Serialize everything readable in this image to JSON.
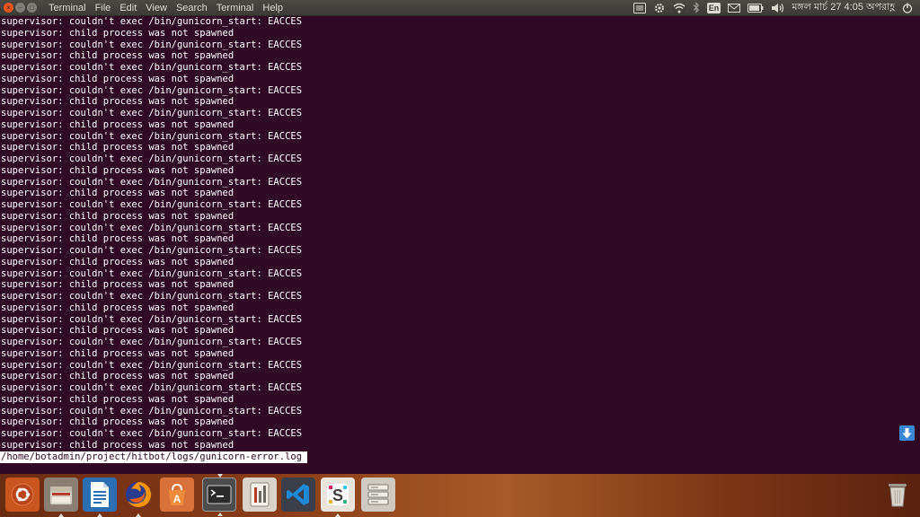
{
  "top_panel": {
    "app_name": "Terminal",
    "menus": [
      "File",
      "Edit",
      "View",
      "Search",
      "Terminal",
      "Help"
    ],
    "keyboard_layout": "En",
    "clock": "মঙ্গল মার্চ 27  4:05 অপরাহ্ণ",
    "icons": [
      "keyboard-icon",
      "settings-gear-icon",
      "wifi-icon",
      "bluetooth-icon",
      "keyboard-language-icon",
      "mail-icon",
      "battery-icon",
      "volume-icon",
      "system-menu-icon"
    ]
  },
  "terminal": {
    "lines": [
      "supervisor: couldn't exec /bin/gunicorn_start: EACCES",
      "supervisor: child process was not spawned",
      "supervisor: couldn't exec /bin/gunicorn_start: EACCES",
      "supervisor: child process was not spawned",
      "supervisor: couldn't exec /bin/gunicorn_start: EACCES",
      "supervisor: child process was not spawned",
      "supervisor: couldn't exec /bin/gunicorn_start: EACCES",
      "supervisor: child process was not spawned",
      "supervisor: couldn't exec /bin/gunicorn_start: EACCES",
      "supervisor: child process was not spawned",
      "supervisor: couldn't exec /bin/gunicorn_start: EACCES",
      "supervisor: child process was not spawned",
      "supervisor: couldn't exec /bin/gunicorn_start: EACCES",
      "supervisor: child process was not spawned",
      "supervisor: couldn't exec /bin/gunicorn_start: EACCES",
      "supervisor: child process was not spawned",
      "supervisor: couldn't exec /bin/gunicorn_start: EACCES",
      "supervisor: child process was not spawned",
      "supervisor: couldn't exec /bin/gunicorn_start: EACCES",
      "supervisor: child process was not spawned",
      "supervisor: couldn't exec /bin/gunicorn_start: EACCES",
      "supervisor: child process was not spawned",
      "supervisor: couldn't exec /bin/gunicorn_start: EACCES",
      "supervisor: child process was not spawned",
      "supervisor: couldn't exec /bin/gunicorn_start: EACCES",
      "supervisor: child process was not spawned",
      "supervisor: couldn't exec /bin/gunicorn_start: EACCES",
      "supervisor: child process was not spawned",
      "supervisor: couldn't exec /bin/gunicorn_start: EACCES",
      "supervisor: child process was not spawned",
      "supervisor: couldn't exec /bin/gunicorn_start: EACCES",
      "supervisor: child process was not spawned",
      "supervisor: couldn't exec /bin/gunicorn_start: EACCES",
      "supervisor: child process was not spawned",
      "supervisor: couldn't exec /bin/gunicorn_start: EACCES",
      "supervisor: child process was not spawned",
      "supervisor: couldn't exec /bin/gunicorn_start: EACCES",
      "supervisor: child process was not spawned"
    ],
    "status_line": "/home/botadmin/project/hitbot/logs/gunicorn-error.log",
    "text_color": "#ffffff",
    "background_color": "#300a24"
  },
  "dock": {
    "items": [
      {
        "name": "dash-home-icon",
        "running": false
      },
      {
        "name": "files-icon",
        "running": true
      },
      {
        "name": "libreoffice-writer-icon",
        "running": true
      },
      {
        "name": "firefox-icon",
        "running": true
      },
      {
        "name": "software-center-icon",
        "running": false
      },
      {
        "name": "terminal-icon",
        "running": true
      },
      {
        "name": "system-monitor-icon",
        "running": false
      },
      {
        "name": "visual-studio-code-icon",
        "running": false
      },
      {
        "name": "slack-icon",
        "running": true
      },
      {
        "name": "server-storage-icon",
        "running": false
      },
      {
        "name": "trash-icon",
        "running": false
      }
    ]
  }
}
